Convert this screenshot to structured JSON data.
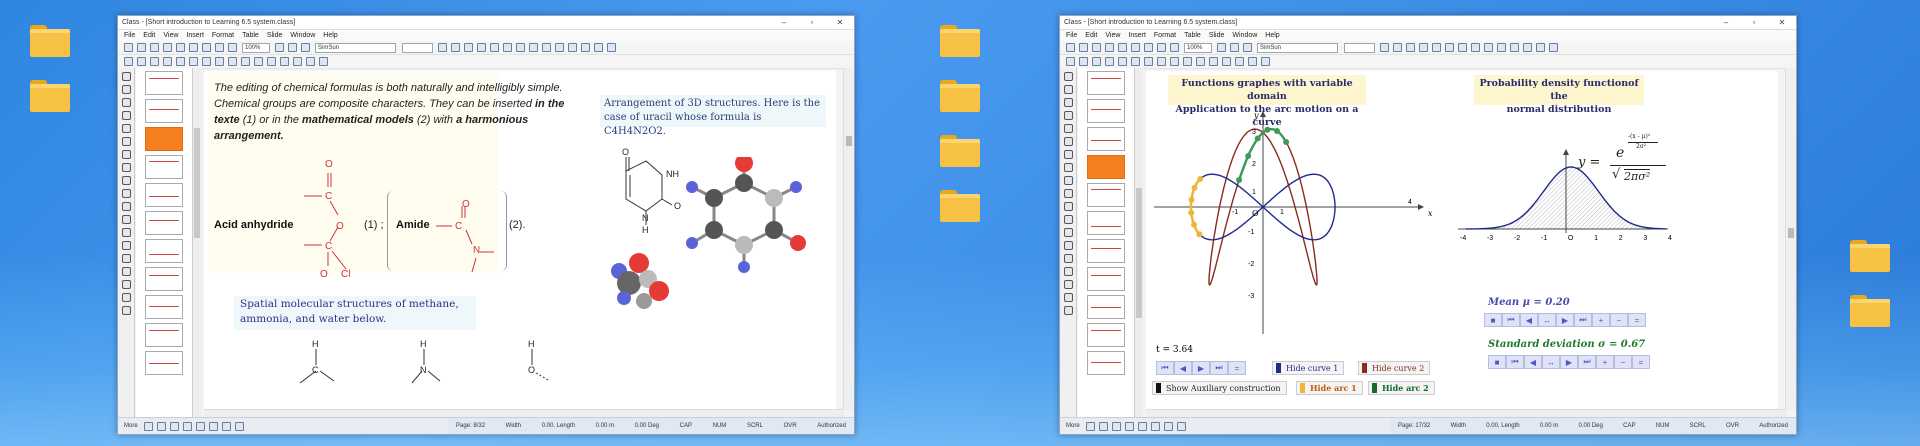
{
  "desktop": {
    "folders_left": [
      "folder",
      "folder"
    ],
    "folders_mid": [
      "folder",
      "folder",
      "folder",
      "folder"
    ],
    "folders_right": [
      "folder",
      "folder"
    ]
  },
  "win1": {
    "title": "Class - [Short introduction to Learning 6.5 system.class]",
    "menu": [
      "File",
      "Edit",
      "View",
      "Insert",
      "Format",
      "Table",
      "Slide",
      "Window",
      "Help"
    ],
    "zoom": "100%",
    "font": "SimSun",
    "more": "More",
    "status": {
      "page": "Page: 8/32",
      "width": "Width",
      "w_val": "0.00, Length",
      "l_val": "0.00 m",
      "deg": "0.00 Deg",
      "caps": "CAP",
      "num": "NUM",
      "scrl": "SCRL",
      "ovr": "OVR",
      "auth": "Authorized"
    },
    "slide": {
      "p1a": "The editing of chemical formulas is both naturally and intelligibly simple. Chemical groups are composite characters. They can be inserted ",
      "p1b": "in the texte",
      "p1c": " (1) or in the ",
      "p1d": "mathematical models",
      "p1e": " (2) with ",
      "p1f": "a harmonious arrangement.",
      "acid_label": "Acid anhydride",
      "eq1": "(1) ;",
      "amide_label": "Amide",
      "eq2": "(2).",
      "arr_text": "Arrangement of 3D structures. Here is the case of uracil whose formula is C",
      "arr_formula": "4H4N2O2.",
      "spatial_text": "Spatial molecular structures of methane, ammonia, and water below.",
      "atoms": {
        "o": "O",
        "c": "C",
        "cl": "Cl",
        "n": "N",
        "h": "H",
        "nh": "NH"
      }
    }
  },
  "win2": {
    "title": "Class - [Short introduction to Learning 6.5 system.class]",
    "menu": [
      "File",
      "Edit",
      "View",
      "Insert",
      "Format",
      "Table",
      "Slide",
      "Window",
      "Help"
    ],
    "zoom": "100%",
    "font": "SimSun",
    "more": "More",
    "status": {
      "page": "Page: 17/32",
      "width": "Width",
      "w_val": "0.00, Length",
      "l_val": "0.00 m",
      "deg": "0.00 Deg",
      "caps": "CAP",
      "num": "NUM",
      "scrl": "SCRL",
      "ovr": "OVR",
      "auth": "Authorized"
    },
    "slide": {
      "fg_title1": "Functions graphes with variable domain",
      "fg_title2": "Application to the arc motion on a curve",
      "pd_title1": "Probability density functionof the",
      "pd_title2": "normal distribution",
      "t_label": "t = 3.64",
      "x_axis": "x",
      "y_axis": "y",
      "origin": "O",
      "x_ticks": [
        "-1",
        "1",
        "4"
      ],
      "y_ticks": [
        "3",
        "2",
        "1",
        "-1",
        "-2",
        "-3"
      ],
      "pd_ticks": [
        "-4",
        "-3",
        "-2",
        "-1",
        "O",
        "1",
        "2",
        "3",
        "4"
      ],
      "formula_y": "y =",
      "formula_e": "e",
      "formula_exp_num": "-(x - μ)²",
      "formula_exp_den": "2σ²",
      "formula_den": "2πσ²",
      "mean_label": "Mean μ = 0.20",
      "sd_label": "Standard deviation σ = 0.67",
      "hide_curve1": "Hide curve 1",
      "hide_curve2": "Hide curve 2",
      "show_aux": "Show Auxiliary construction",
      "hide_arc1": "Hide arc 1",
      "hide_arc2": "Hide arc 2",
      "controls": [
        "■",
        "⏮",
        "◀",
        "↔",
        "▶",
        "⏭",
        "+",
        "−",
        "="
      ]
    },
    "colors": {
      "blue": "#1f2a8c",
      "red": "#8b2a1e",
      "green": "#3f9a5a",
      "orange": "#f0b43a",
      "dark_green": "#166b2a"
    }
  }
}
